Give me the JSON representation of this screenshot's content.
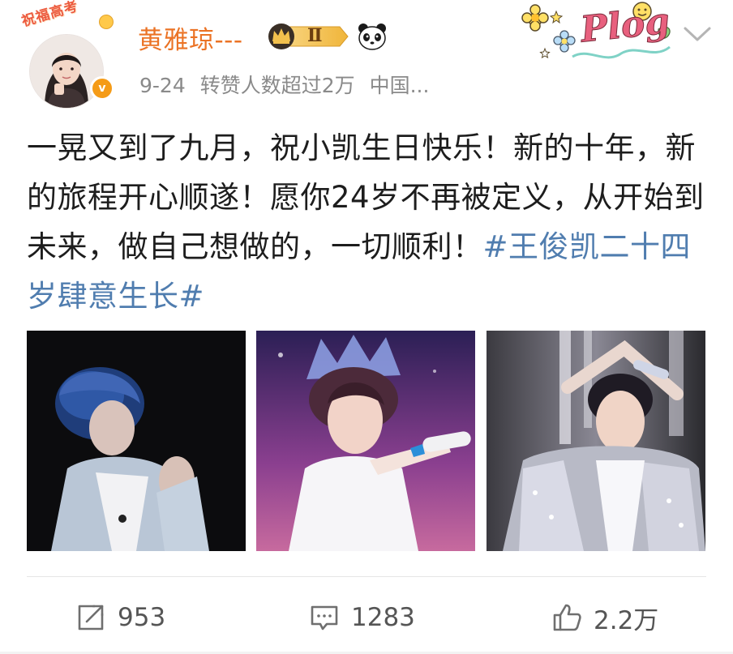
{
  "header": {
    "avatar_banner": "祝福高考",
    "username": "黄雅琼---",
    "vip_level": "Ⅱ",
    "date": "9-24",
    "repost_note": "转赞人数超过2万",
    "location": "中国...",
    "sticker_text": "Plog",
    "verified_mark": "v"
  },
  "post": {
    "text": "一晃又到了九月，祝小凯生日快乐！新的十年，新的旅程开心顺遂！愿你24岁不再被定义，从开始到未来，做自己想做的，一切顺利！",
    "hashtag": "#王俊凯二十四岁肆意生长#"
  },
  "photos": [
    {
      "subject": "performer-blue-hair-silver-jacket"
    },
    {
      "subject": "performer-with-microphone-purple-stage"
    },
    {
      "subject": "performer-sequin-jacket-heart-gesture"
    }
  ],
  "actions": {
    "repost_count": "953",
    "comment_count": "1283",
    "like_count": "2.2万"
  },
  "icons": {
    "repost": "repost-icon",
    "comment": "comment-icon",
    "like": "thumbs-up-icon",
    "menu": "chevron-down-icon",
    "vip": "crown-vip-icon",
    "panda": "panda-icon"
  },
  "colors": {
    "username": "#eb7325",
    "hashtag": "#507daf",
    "meta": "#8a8a8a",
    "verified": "#f59b17"
  }
}
